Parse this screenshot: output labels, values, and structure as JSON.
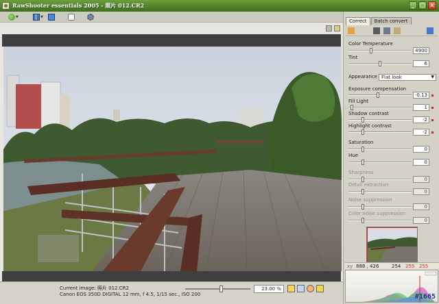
{
  "window": {
    "title": "RawShooter essentials 2005 - 照片 012.CR2",
    "minimize_glyph": "_",
    "maximize_glyph": "□",
    "close_glyph": "×"
  },
  "toolbar": {
    "icons": [
      "green-dot-icon",
      "panels-icon",
      "single-view-icon",
      "speech-icon",
      "gear-icon"
    ]
  },
  "tabs": [
    {
      "label": "Correct",
      "active": true
    },
    {
      "label": "Batch convert",
      "active": false
    }
  ],
  "panel": {
    "color_temperature": {
      "label": "Color Temperature",
      "value": "4900",
      "level": 0.35
    },
    "tint": {
      "label": "Tint",
      "value": "6",
      "level": 0.5
    },
    "appearance": {
      "label": "Appearance",
      "value": "Flat look"
    },
    "exposure": {
      "label": "Exposure compensation",
      "value": "-0.13",
      "level": 0.47
    },
    "fill_light": {
      "label": "Fill Light",
      "value": "1",
      "level": 0.03
    },
    "shadow_contrast": {
      "label": "Shadow contrast",
      "value": "-2",
      "level": 0.22
    },
    "highlight_contrast": {
      "label": "Highlight contrast",
      "value": "-2",
      "level": 0.22
    },
    "saturation": {
      "label": "Saturation",
      "value": "0",
      "level": 0.22
    },
    "hue": {
      "label": "Hue",
      "value": "0",
      "level": 0.22
    },
    "sharpness": {
      "label": "Sharpness",
      "value": "0",
      "level": 0.22
    },
    "detail_extraction": {
      "label": "Detail extraction",
      "value": "0",
      "level": 0.22
    },
    "noise_suppression": {
      "label": "Noise suppression",
      "value": "0",
      "level": 0.22
    },
    "color_noise_suppression": {
      "label": "Color noise suppression",
      "value": "0",
      "level": 0.22
    }
  },
  "coords": {
    "label": "xy",
    "xy": "888 , 426",
    "r": "254",
    "g": "255",
    "b": "255"
  },
  "status": {
    "current_image": "Current image:  照片 012.CR2",
    "camera": "Canon EOS 350D DIGITAL   12 mm, f 4.5, 1/15 sec., ISO 200",
    "zoom": "23.00 %",
    "zoom_level": 0.23
  },
  "counter": "#1665",
  "colors": {
    "title_green": "#4f8128",
    "accent_red": "#c62b1d",
    "panel_bg": "#d4d2c6"
  }
}
